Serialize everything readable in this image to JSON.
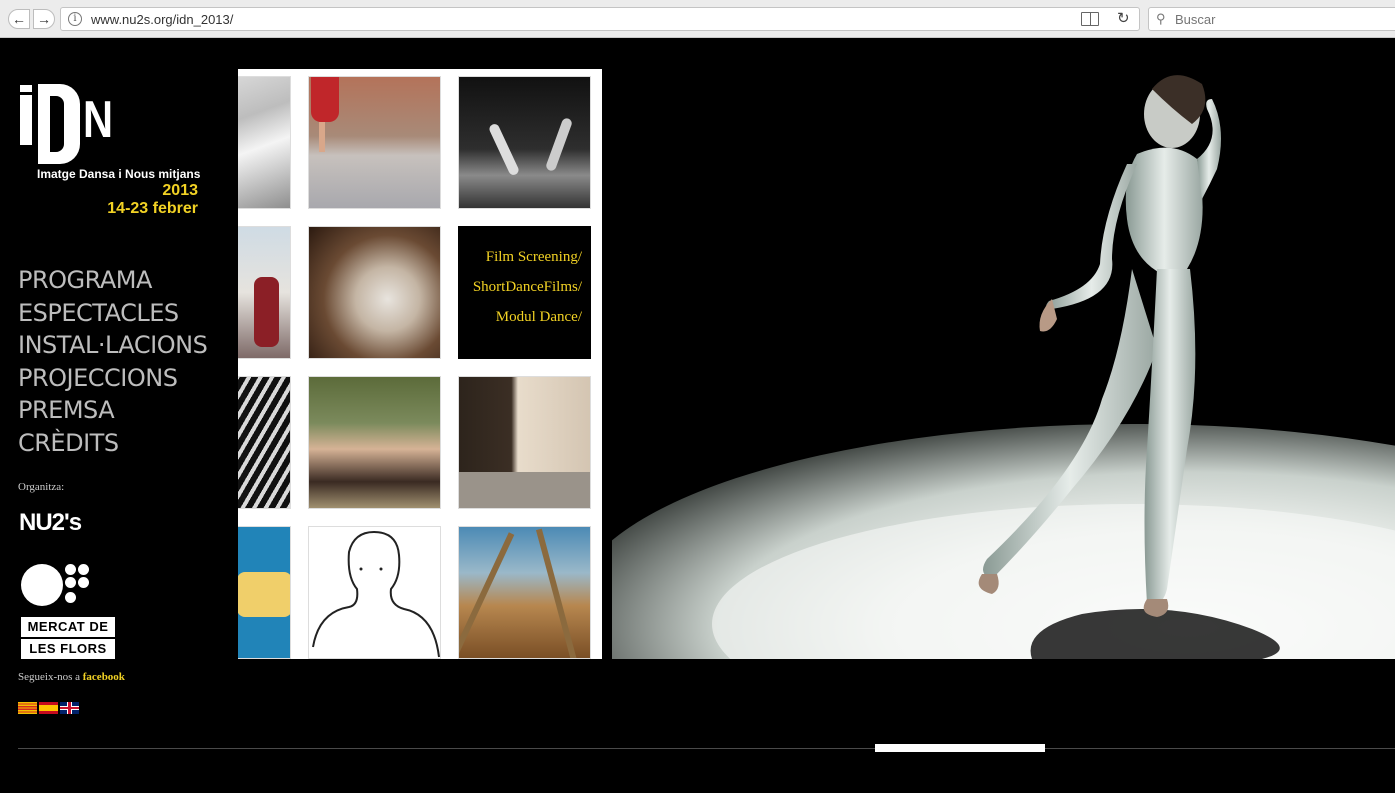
{
  "browser": {
    "url": "www.nu2s.org/idn_2013/",
    "search_placeholder": "Buscar"
  },
  "logo": {
    "letters_n": "N",
    "subtitle": "Imatge Dansa i Nous mitjans",
    "year": "2013",
    "dates": "14-23 febrer"
  },
  "menu": {
    "items": [
      {
        "label": "PROGRAMA"
      },
      {
        "label": "ESPECTACLES"
      },
      {
        "label": "INSTAL·LACIONS"
      },
      {
        "label": "PROJECCIONS"
      },
      {
        "label": "PREMSA"
      },
      {
        "label": "CRÈDITS"
      }
    ]
  },
  "organizer": {
    "label": "Organitza:",
    "nu2s": "NU2's",
    "mercat_line1": "MERCAT DE",
    "mercat_line2": "LES FLORS"
  },
  "social": {
    "prefix": "Segueix-nos a",
    "link": "facebook"
  },
  "poster": {
    "film_lines": [
      "Film Screening/",
      "ShortDanceFilms/",
      "Modul Dance/"
    ]
  },
  "colors": {
    "accent_yellow": "#f2d224",
    "menu_gray": "#bdbdbd",
    "background": "#000000"
  }
}
